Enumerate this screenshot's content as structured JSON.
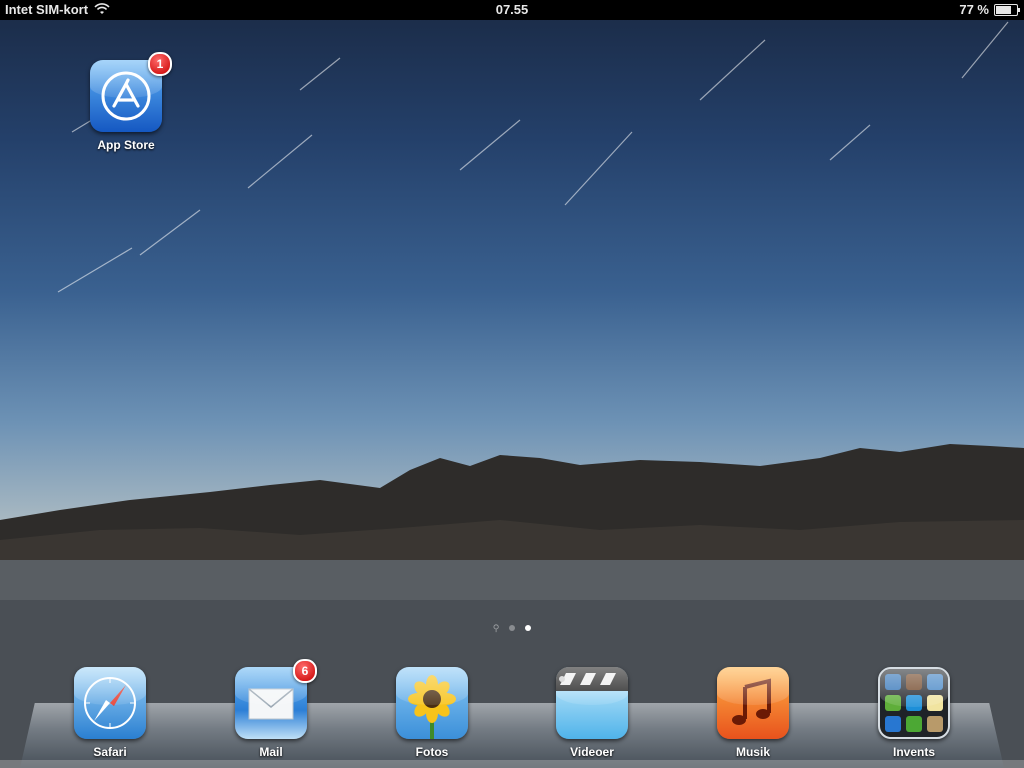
{
  "status_bar": {
    "carrier": "Intet SIM-kort",
    "time": "07.55",
    "battery_percent": "77 %",
    "battery_level": 0.77
  },
  "home_apps": [
    {
      "label": "App Store",
      "badge": "1",
      "icon": "app-store-icon",
      "color": "#1e73d8"
    }
  ],
  "page_indicator": {
    "pages": 2,
    "current": 2,
    "has_search_page": true
  },
  "dock_apps": [
    {
      "label": "Safari",
      "icon": "safari-compass-icon",
      "badge": ""
    },
    {
      "label": "Mail",
      "icon": "mail-envelope-icon",
      "badge": "6"
    },
    {
      "label": "Fotos",
      "icon": "sunflower-photos-icon",
      "badge": ""
    },
    {
      "label": "Videoer",
      "icon": "clapperboard-icon",
      "badge": ""
    },
    {
      "label": "Musik",
      "icon": "music-note-icon",
      "badge": ""
    },
    {
      "label": "Invents",
      "icon": "folder-icon",
      "badge": ""
    }
  ],
  "colors": {
    "badge_red": "#d40000",
    "status_bar": "#000000"
  }
}
